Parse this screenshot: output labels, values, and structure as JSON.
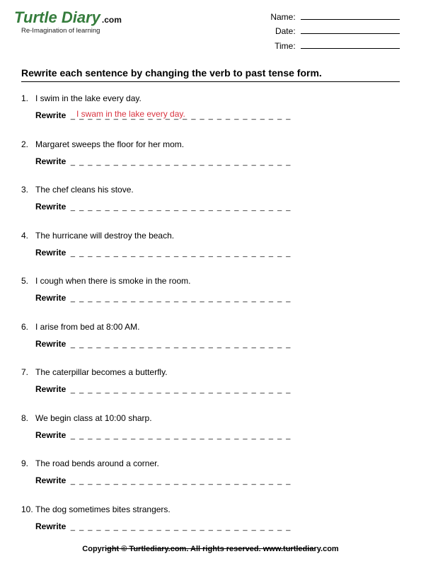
{
  "logo": {
    "main": "Turtle Diary",
    "dotcom": ".com",
    "tagline": "Re-Imagination of learning"
  },
  "meta": {
    "name_label": "Name:",
    "date_label": "Date:",
    "time_label": "Time:"
  },
  "instruction": "Rewrite each sentence by changing the verb to past tense form.",
  "rewrite_label": "Rewrite",
  "dashes": "_ _ _ _ _ _ _ _ _ _ _ _ _ _ _ _ _ _ _ _ _ _ _ _ _ _",
  "questions": [
    {
      "num": "1.",
      "text": "I swim in the lake every day.",
      "answer": "I swam in the lake every day."
    },
    {
      "num": "2.",
      "text": "Margaret sweeps the floor for her mom.",
      "answer": ""
    },
    {
      "num": "3.",
      "text": "The chef cleans his stove.",
      "answer": ""
    },
    {
      "num": "4.",
      "text": "The hurricane will destroy the beach.",
      "answer": ""
    },
    {
      "num": "5.",
      "text": "I cough when there is smoke in the room.",
      "answer": ""
    },
    {
      "num": "6.",
      "text": "I arise from bed at 8:00 AM.",
      "answer": ""
    },
    {
      "num": "7.",
      "text": "The caterpillar becomes a butterfly.",
      "answer": ""
    },
    {
      "num": "8.",
      "text": "We begin class at 10:00 sharp.",
      "answer": ""
    },
    {
      "num": "9.",
      "text": "The road bends around a corner.",
      "answer": ""
    },
    {
      "num": "10.",
      "text": "The dog sometimes bites strangers.",
      "answer": ""
    }
  ],
  "footer": "Copyright © Turtlediary.com. All rights reserved. www.turtlediary.com"
}
